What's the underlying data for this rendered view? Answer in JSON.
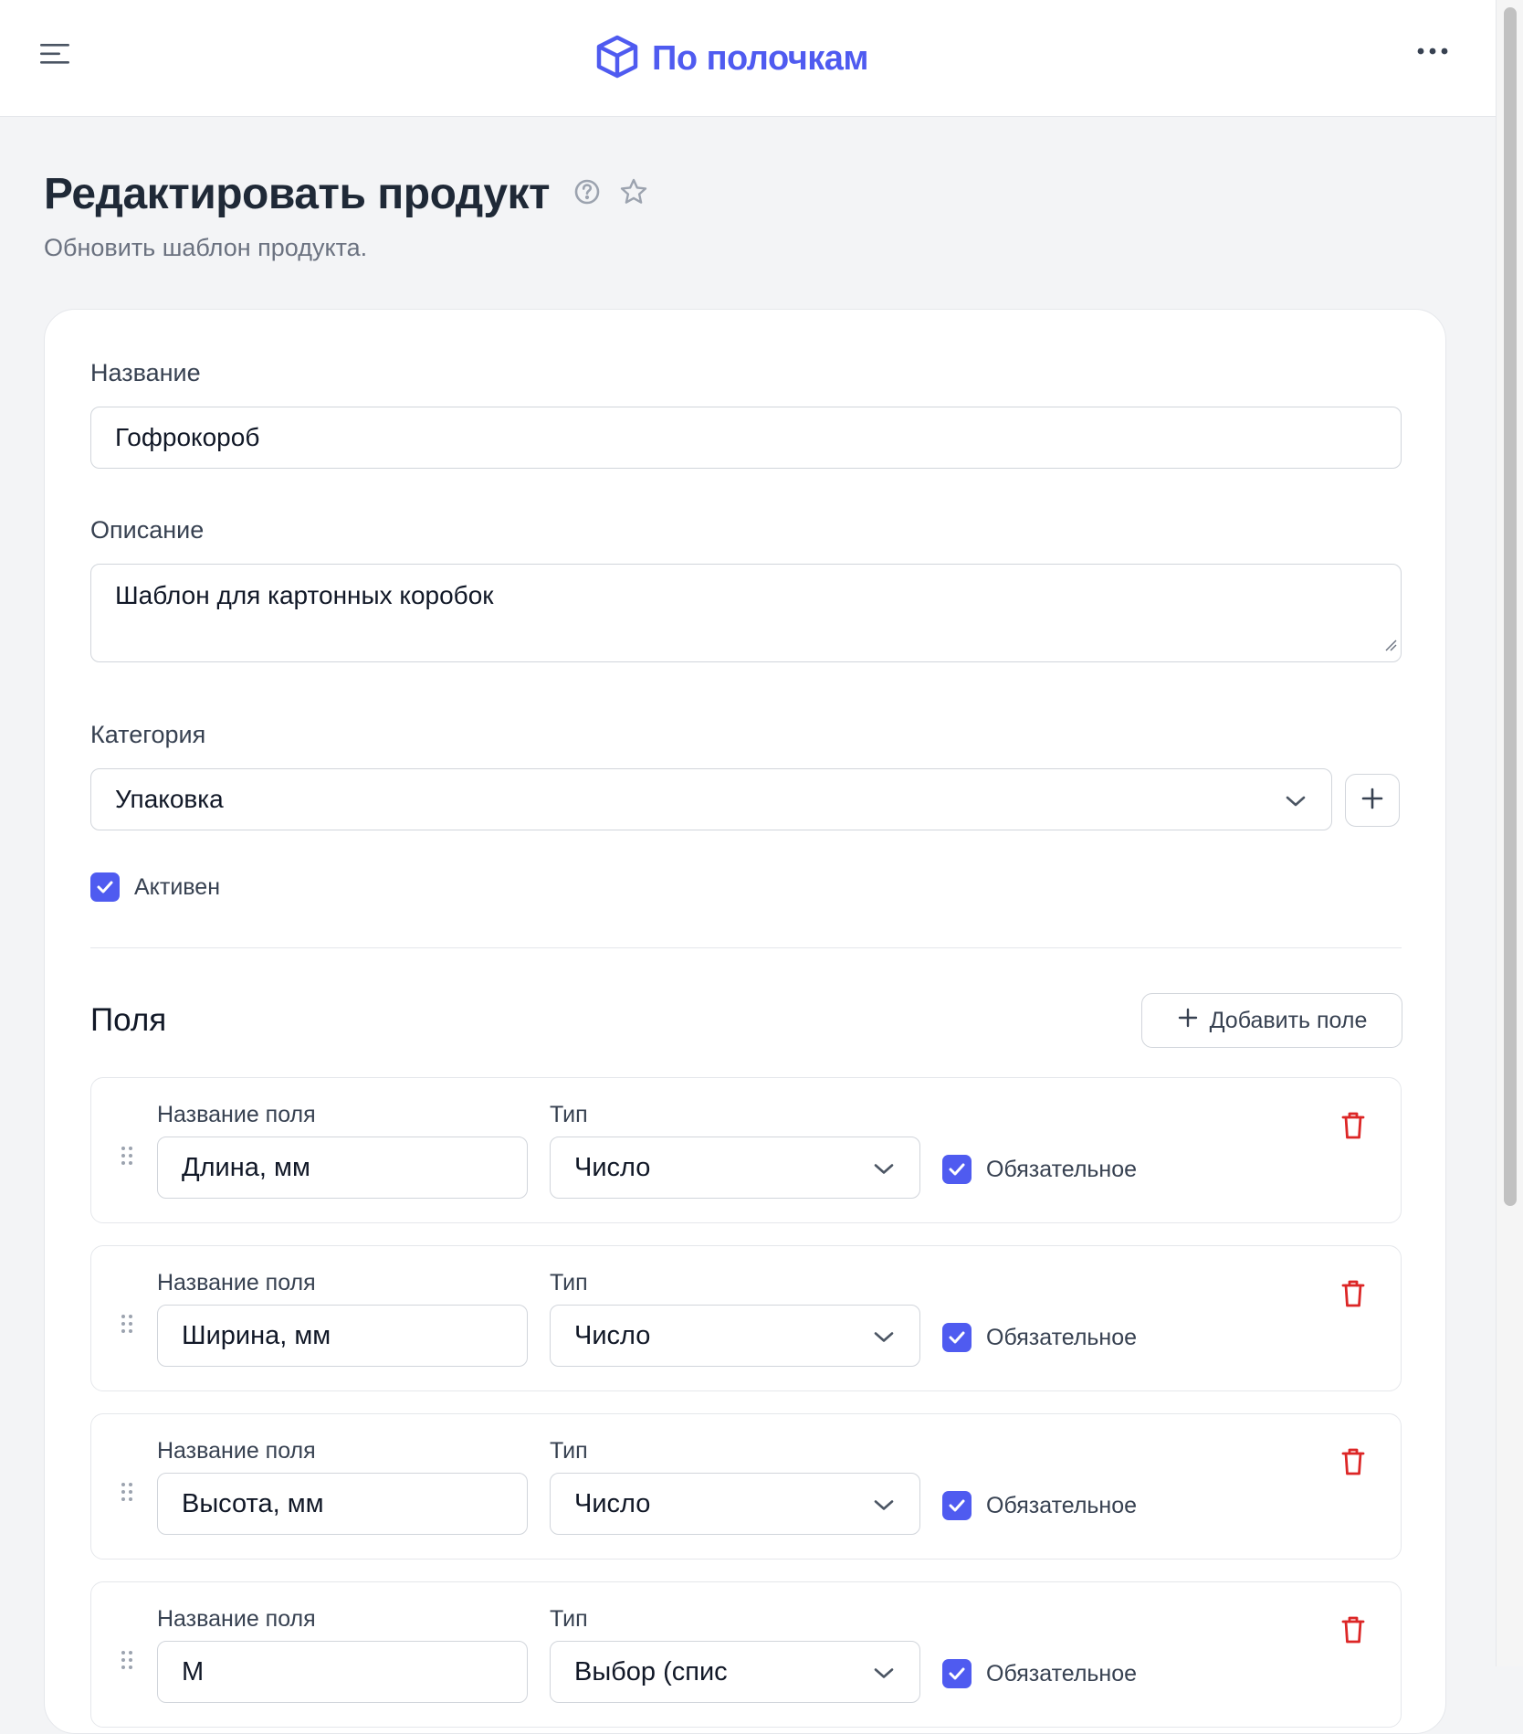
{
  "app": {
    "name": "По полочкам",
    "brand_color": "#4f5bf0"
  },
  "header": {
    "menu_icon": "menu-icon",
    "logo_icon": "box-icon",
    "more_icon": "more-horizontal-icon"
  },
  "page": {
    "title": "Редактировать продукт",
    "subtitle": "Обновить шаблон продукта.",
    "help_icon": "help-circle-icon",
    "favorite_icon": "star-icon"
  },
  "form": {
    "name_label": "Название",
    "name_value": "Гофрокороб",
    "description_label": "Описание",
    "description_value": "Шаблон для картонных коробок",
    "category_label": "Категория",
    "category_value": "Упаковка",
    "active_label": "Активен",
    "active_checked": true
  },
  "fields_section": {
    "title": "Поля",
    "add_button_label": "Добавить поле",
    "name_label": "Название поля",
    "type_label": "Тип",
    "required_label": "Обязательное",
    "rows": [
      {
        "name": "Длина, мм",
        "type": "Число",
        "required": true
      },
      {
        "name": "Ширина, мм",
        "type": "Число",
        "required": true
      },
      {
        "name": "Высота, мм",
        "type": "Число",
        "required": true
      },
      {
        "name": "М",
        "type": "Выбор (спис",
        "required": true
      }
    ]
  }
}
